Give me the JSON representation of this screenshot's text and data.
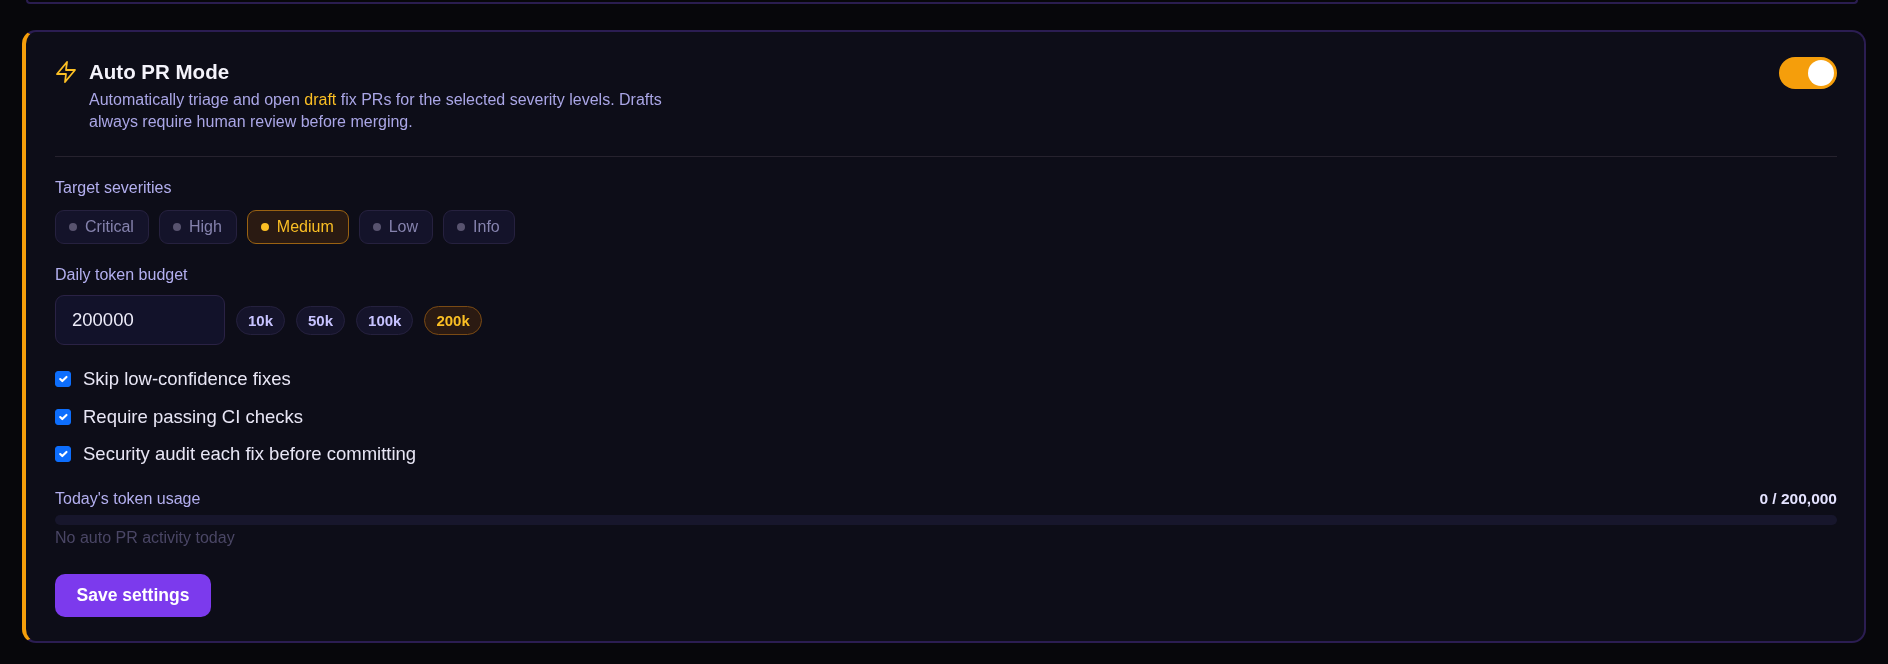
{
  "panel": {
    "title": "Auto PR Mode",
    "description": "Automatically triage and open **draft** fix PRs for the selected severity levels. Drafts always require human review before merging.",
    "enabled": true
  },
  "severities": {
    "label": "Target severities",
    "options": [
      {
        "label": "Critical",
        "selected": false
      },
      {
        "label": "High",
        "selected": false
      },
      {
        "label": "Medium",
        "selected": true
      },
      {
        "label": "Low",
        "selected": false
      },
      {
        "label": "Info",
        "selected": false
      }
    ]
  },
  "budget": {
    "label": "Daily token budget",
    "value": "200000",
    "presets": [
      {
        "label": "10k",
        "selected": false
      },
      {
        "label": "50k",
        "selected": false
      },
      {
        "label": "100k",
        "selected": false
      },
      {
        "label": "200k",
        "selected": true
      }
    ]
  },
  "checks": [
    {
      "label": "Skip low-confidence fixes",
      "checked": true
    },
    {
      "label": "Require passing CI checks",
      "checked": true
    },
    {
      "label": "Security audit each fix before committing",
      "checked": true
    }
  ],
  "usage": {
    "label": "Today's token usage",
    "reading": "0 / 200,000",
    "level": 0,
    "note": "No auto PR activity today"
  },
  "save_button": {
    "label": "Save settings"
  }
}
